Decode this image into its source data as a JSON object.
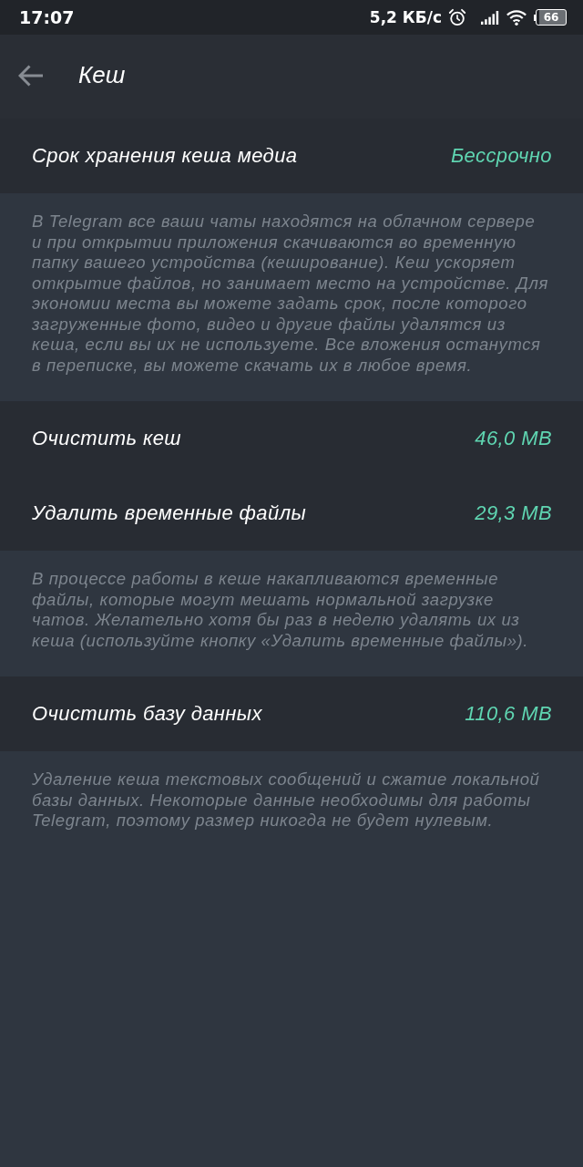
{
  "status_bar": {
    "time": "17:07",
    "network_speed": "5,2 КБ/с",
    "battery": "66"
  },
  "header": {
    "title": "Кеш"
  },
  "sections": [
    {
      "rows": [
        {
          "label": "Срок хранения кеша медиа",
          "value": "Бессрочно"
        }
      ],
      "note": "В Telegram все ваши чаты находятся на облачном сервере и при открытии приложения скачиваются во временную папку вашего устройства (кеширование). Кеш ускоряет открытие файлов, но занимает место на устройстве. Для экономии места вы можете задать срок, после которого загруженные фото, видео и другие файлы удалятся из кеша, если вы их не используете. Все вложения останутся в переписке, вы можете скачать их в любое время."
    },
    {
      "rows": [
        {
          "label": "Очистить кеш",
          "value": "46,0 MB"
        },
        {
          "label": "Удалить временные файлы",
          "value": "29,3 MB"
        }
      ],
      "note": "В процессе работы в кеше накапливаются временные файлы, которые могут мешать нормальной загрузке чатов. Желательно хотя бы раз в неделю удалять их из кеша (используйте кнопку «Удалить временные файлы»)."
    },
    {
      "rows": [
        {
          "label": "Очистить базу данных",
          "value": "110,6 MB"
        }
      ],
      "note": "Удаление кеша текстовых сообщений и сжатие локальной базы данных. Некоторые данные необходимы для работы Telegram, поэтому размер никогда не будет нулевым."
    }
  ]
}
